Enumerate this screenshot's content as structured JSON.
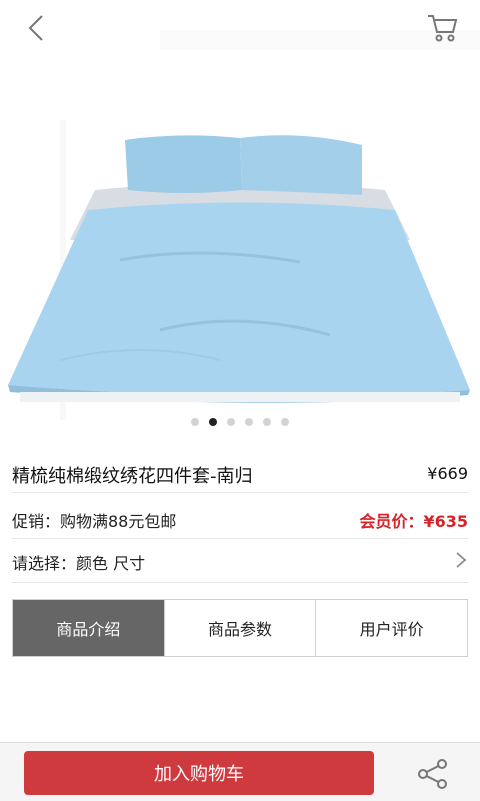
{
  "header": {
    "back_icon": "chevron-left-icon",
    "cart_icon": "cart-icon"
  },
  "gallery": {
    "image": "light-blue bedding set",
    "dot_count": 6,
    "active_index": 1
  },
  "product": {
    "title": "精梳纯棉缎纹绣花四件套-南归",
    "price": "¥669"
  },
  "promotion": {
    "text": "促销：购物满88元包邮",
    "member_price": "会员价：¥635"
  },
  "options": {
    "text": "请选择：颜色 尺寸"
  },
  "tabs": [
    {
      "label": "商品介绍",
      "active": true
    },
    {
      "label": "商品参数",
      "active": false
    },
    {
      "label": "用户评价",
      "active": false
    }
  ],
  "bottom": {
    "add_to_cart": "加入购物车",
    "share_icon": "share-icon"
  },
  "colors": {
    "accent": "#cf3a3f",
    "member_price": "#d6232a",
    "active_tab": "#666666",
    "bedding": "#a7d3ee"
  }
}
